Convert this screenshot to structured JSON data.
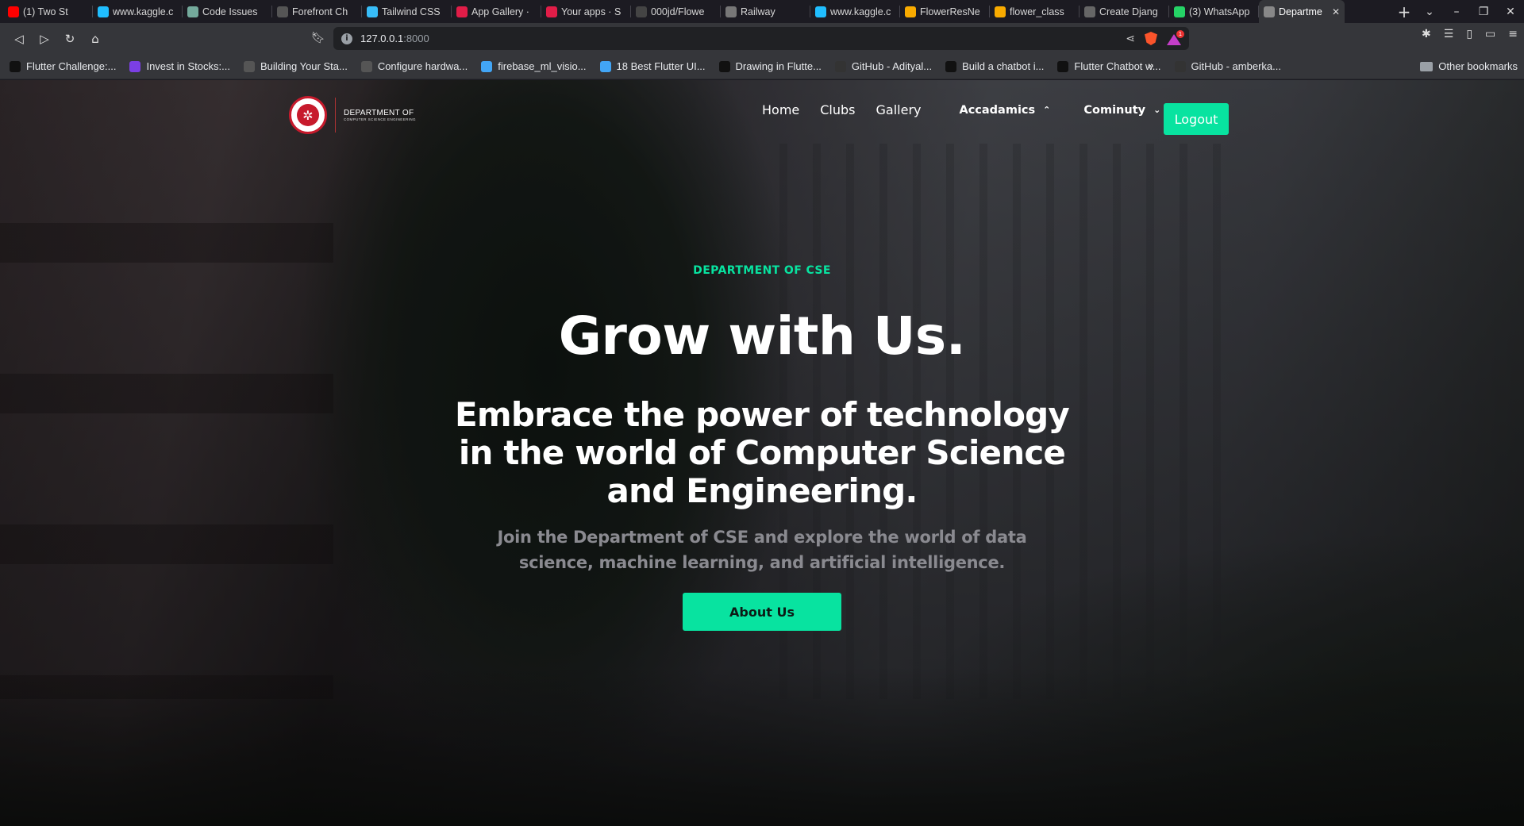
{
  "browser": {
    "tabs": [
      {
        "title": "(1) Two St",
        "icon": "youtube-icon",
        "color": "#ff0000"
      },
      {
        "title": "www.kaggle.c",
        "icon": "kaggle-icon",
        "color": "#20beff"
      },
      {
        "title": "Code Issues",
        "icon": "chatgpt-icon",
        "color": "#74aa9c"
      },
      {
        "title": "Forefront Ch",
        "icon": "forefront-icon",
        "color": "#555555"
      },
      {
        "title": "Tailwind CSS",
        "icon": "tailwind-icon",
        "color": "#38bdf8"
      },
      {
        "title": "App Gallery ·",
        "icon": "crown-icon",
        "color": "#e11d48"
      },
      {
        "title": "Your apps · S",
        "icon": "streamlit-icon",
        "color": "#e11d48"
      },
      {
        "title": "000jd/Flowe",
        "icon": "github-icon",
        "color": "#444444"
      },
      {
        "title": "Railway",
        "icon": "railway-icon",
        "color": "#777777"
      },
      {
        "title": "www.kaggle.c",
        "icon": "kaggle-icon",
        "color": "#20beff"
      },
      {
        "title": "FlowerResNe",
        "icon": "colab-icon",
        "color": "#f9ab00"
      },
      {
        "title": "flower_class",
        "icon": "colab-icon",
        "color": "#f9ab00"
      },
      {
        "title": "Create Djang",
        "icon": "page-icon",
        "color": "#666666"
      },
      {
        "title": "(3) WhatsApp",
        "icon": "whatsapp-icon",
        "color": "#25d366"
      },
      {
        "title": "Departme",
        "icon": "globe-icon",
        "color": "#888888",
        "active": true
      }
    ],
    "url_host": "127.0.0.1",
    "url_port": ":8000",
    "rewards_badge": "1",
    "bookmarks": [
      {
        "title": "Flutter Challenge:...",
        "icon": "video-icon"
      },
      {
        "title": "Invest in Stocks:...",
        "icon": "gradient-icon"
      },
      {
        "title": "Building Your Sta...",
        "icon": "globe-icon"
      },
      {
        "title": "Configure hardwa...",
        "icon": "globe-icon"
      },
      {
        "title": "firebase_ml_visio...",
        "icon": "flutter-icon"
      },
      {
        "title": "18 Best Flutter UI...",
        "icon": "flutter-icon"
      },
      {
        "title": "Drawing in Flutte...",
        "icon": "video-icon"
      },
      {
        "title": "GitHub - Adityal...",
        "icon": "github-icon"
      },
      {
        "title": "Build a chatbot i...",
        "icon": "video-icon"
      },
      {
        "title": "Flutter Chatbot w...",
        "icon": "video-icon"
      },
      {
        "title": "GitHub - amberka...",
        "icon": "github-icon"
      }
    ],
    "bookmarks_more": "»",
    "other_bookmarks": "Other bookmarks"
  },
  "site": {
    "logo": {
      "line1": "DEPARTMENT OF",
      "line2": "COMPUTER SCIENCE ENGINEERING"
    },
    "nav": {
      "home": "Home",
      "clubs": "Clubs",
      "gallery": "Gallery",
      "academics": "Accadamics",
      "community": "Cominuty",
      "logout": "Logout"
    },
    "hero": {
      "eyebrow": "DEPARTMENT OF CSE",
      "headline": "Grow with Us.",
      "subhead": "Embrace the power of technology in the world of Computer Science and Engineering.",
      "lead": "Join the Department of CSE and explore the world of data science, machine learning, and artificial intelligence.",
      "cta": "About Us"
    }
  },
  "colors": {
    "accent": "#08e3a0",
    "browser_bg": "#1c1b22",
    "toolbar_bg": "#35363a",
    "seal_red": "#c71a2c"
  }
}
